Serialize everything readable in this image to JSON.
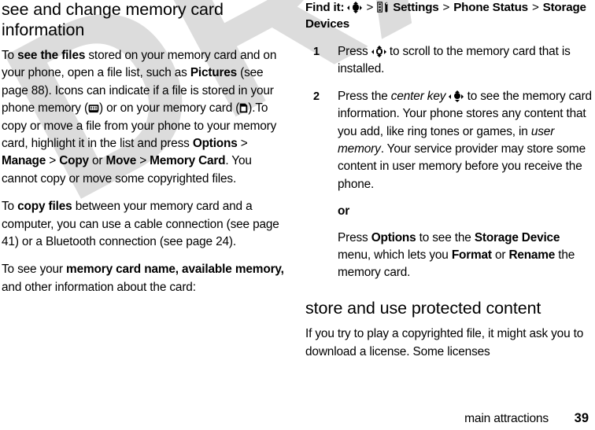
{
  "document": {
    "watermark": "DRAFT",
    "watermark_color": "#dcdcdc",
    "text_color": "#000000",
    "background_color": "#ffffff"
  },
  "left_column": {
    "heading": "see and change memory card information",
    "paragraph1": {
      "seg1": "To ",
      "bold1": "see the files",
      "seg2": " stored on your memory card and on your phone, open a file list, such as ",
      "ui1": "Pictures",
      "seg3": " (see page 88). Icons can indicate if a file is stored in your phone memory (",
      "icon1": "telephone-icon",
      "seg4": ") or on your memory card (",
      "icon2": "memory-card-icon",
      "seg5": ").To copy or move a file from your phone to your memory card, highlight it in the list and press ",
      "ui2": "Options",
      "sep1": " > ",
      "ui3": "Manage",
      "sep2": " > ",
      "ui4": "Copy",
      "seg6": " or ",
      "ui5": "Move",
      "sep3": " > ",
      "ui6": "Memory Card",
      "seg7": ". You cannot copy or move some copyrighted files."
    },
    "paragraph2": {
      "seg1": "To ",
      "bold1": "copy files",
      "seg2": " between your memory card and a computer, you can use a cable connection (see page 41) or a Bluetooth connection (see page 24)."
    },
    "paragraph3": {
      "seg1": "To see your ",
      "bold1": "memory card name, available memory,",
      "seg2": " and other information about the card:"
    }
  },
  "right_column": {
    "find_it": {
      "label": "Find it:",
      "icon1": "nav-key-icon",
      "sep1": ">",
      "icon2": "settings-tools-icon",
      "item1": "Settings",
      "sep2": ">",
      "item2": "Phone Status",
      "sep3": ">",
      "item3": "Storage Devices"
    },
    "steps": [
      {
        "number": "1",
        "seg1": "Press ",
        "icon": "scroll-key-icon",
        "seg2": " to scroll to the memory card that is installed."
      },
      {
        "number": "2",
        "seg1": "Press the ",
        "italic1": "center key",
        "seg2": " ",
        "icon": "center-key-icon",
        "seg3": " to see the memory card information. Your phone stores any content that you add, like ring tones or games, in ",
        "italic2": "user memory",
        "seg4": ". Your service provider may store some content in user memory before you receive the phone."
      }
    ],
    "or_label": "or",
    "options_paragraph": {
      "seg1": "Press ",
      "ui1": "Options",
      "seg2": " to see the ",
      "ui2": "Storage Device",
      "seg3": " menu, which lets you ",
      "ui3": "Format",
      "seg4": " or ",
      "ui4": "Rename",
      "seg5": " the memory card."
    },
    "heading2": "store and use protected content",
    "paragraph4": "If you try to play a copyrighted file, it might ask you to download a license. Some licenses"
  },
  "footer": {
    "section": "main attractions",
    "page_number": "39"
  }
}
